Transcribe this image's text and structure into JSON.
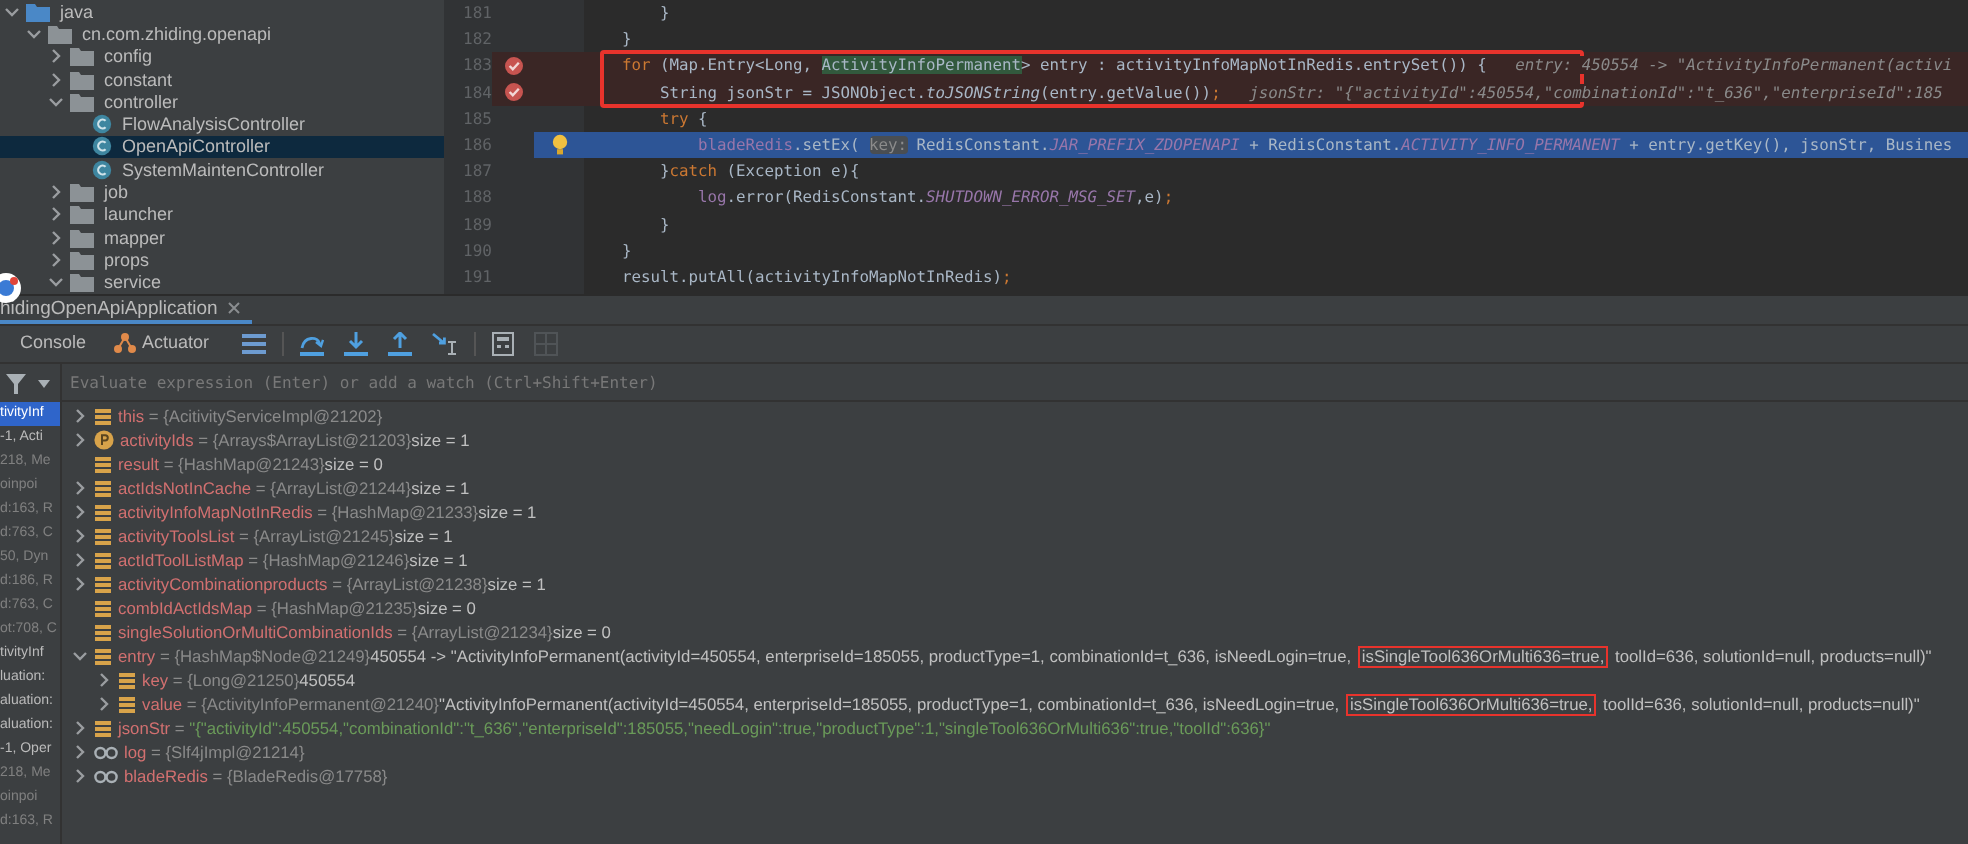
{
  "project_tree": [
    {
      "label": "java",
      "kind": "source-root",
      "expanded": true,
      "selected": false,
      "children": [
        {
          "label": "cn.com.zhiding.openapi",
          "kind": "package",
          "expanded": true,
          "selected": false,
          "children": [
            {
              "label": "config",
              "kind": "package",
              "expanded": false,
              "selected": false
            },
            {
              "label": "constant",
              "kind": "package",
              "expanded": false,
              "selected": false
            },
            {
              "label": "controller",
              "kind": "package",
              "expanded": true,
              "selected": false,
              "children": [
                {
                  "label": "FlowAnalysisController",
                  "kind": "class",
                  "selected": false
                },
                {
                  "label": "OpenApiController",
                  "kind": "class",
                  "selected": true
                },
                {
                  "label": "SystemMaintenController",
                  "kind": "class",
                  "selected": false
                }
              ]
            },
            {
              "label": "job",
              "kind": "package",
              "expanded": false,
              "selected": false
            },
            {
              "label": "launcher",
              "kind": "package",
              "expanded": false,
              "selected": false
            },
            {
              "label": "mapper",
              "kind": "package",
              "expanded": false,
              "selected": false
            },
            {
              "label": "props",
              "kind": "package",
              "expanded": false,
              "selected": false
            },
            {
              "label": "service",
              "kind": "package",
              "expanded": true,
              "selected": false
            }
          ]
        }
      ]
    }
  ],
  "code_lines": [
    {
      "number": "181",
      "breakpoint": false,
      "current": false,
      "segments": [
        {
          "kind": "plain",
          "text": "        }"
        }
      ]
    },
    {
      "number": "182",
      "breakpoint": false,
      "current": false,
      "segments": [
        {
          "kind": "plain",
          "text": "    }"
        }
      ]
    },
    {
      "number": "183",
      "breakpoint": true,
      "current": false,
      "segments": [
        {
          "kind": "keyword",
          "text": "    for"
        },
        {
          "kind": "plain",
          "text": " (Map.Entry<Long, "
        },
        {
          "kind": "highlight",
          "text": "ActivityInfoPermanent"
        },
        {
          "kind": "plain",
          "text": "> entry : activityInfoMapNotInRedis.entrySet()) {"
        },
        {
          "kind": "hint",
          "text": "   entry: 450554 -> \"ActivityInfoPermanent(activi"
        }
      ]
    },
    {
      "number": "184",
      "breakpoint": true,
      "current": false,
      "segments": [
        {
          "kind": "plain",
          "text": "        String jsonStr = JSONObject."
        },
        {
          "kind": "italic",
          "text": "toJSONString"
        },
        {
          "kind": "plain",
          "text": "(entry.getValue())"
        },
        {
          "kind": "keyword",
          "text": ";"
        },
        {
          "kind": "hint",
          "text": "   jsonStr: \"{\"activityId\":450554,\"combinationId\":\"t_636\",\"enterpriseId\":185"
        }
      ]
    },
    {
      "number": "185",
      "breakpoint": false,
      "current": false,
      "segments": [
        {
          "kind": "keyword",
          "text": "        try"
        },
        {
          "kind": "plain",
          "text": " {"
        }
      ]
    },
    {
      "number": "186",
      "breakpoint": false,
      "current": true,
      "segments": [
        {
          "kind": "field",
          "text": "            bladeRedis"
        },
        {
          "kind": "plain",
          "text": ".setEx( "
        },
        {
          "kind": "inlay",
          "text": "key:"
        },
        {
          "kind": "plain",
          "text": " RedisConstant."
        },
        {
          "kind": "static",
          "text": "JAR_PREFIX_ZDOPENAPI"
        },
        {
          "kind": "plain",
          "text": " + RedisConstant."
        },
        {
          "kind": "static",
          "text": "ACTIVITY_INFO_PERMANENT"
        },
        {
          "kind": "plain",
          "text": " + entry.getKey(), jsonStr, Busines"
        }
      ]
    },
    {
      "number": "187",
      "breakpoint": false,
      "current": false,
      "segments": [
        {
          "kind": "plain",
          "text": "        }"
        },
        {
          "kind": "keyword",
          "text": "catch"
        },
        {
          "kind": "plain",
          "text": " (Exception e){"
        }
      ]
    },
    {
      "number": "188",
      "breakpoint": false,
      "current": false,
      "segments": [
        {
          "kind": "field",
          "text": "            log"
        },
        {
          "kind": "plain",
          "text": ".error(RedisConstant."
        },
        {
          "kind": "static",
          "text": "SHUTDOWN_ERROR_MSG_SET"
        },
        {
          "kind": "plain",
          "text": ",e)"
        },
        {
          "kind": "keyword",
          "text": ";"
        }
      ]
    },
    {
      "number": "189",
      "breakpoint": false,
      "current": false,
      "segments": [
        {
          "kind": "plain",
          "text": "        }"
        }
      ]
    },
    {
      "number": "190",
      "breakpoint": false,
      "current": false,
      "segments": [
        {
          "kind": "plain",
          "text": "    }"
        }
      ]
    },
    {
      "number": "191",
      "breakpoint": false,
      "current": false,
      "segments": [
        {
          "kind": "plain",
          "text": "    result.putAll(activityInfoMapNotInRedis)"
        },
        {
          "kind": "keyword",
          "text": ";"
        }
      ]
    }
  ],
  "run_tabs": [
    {
      "label": "hidingOpenApiApplication",
      "selected": true
    }
  ],
  "debug_tabs": [
    {
      "label": "Console",
      "kind": "console",
      "selected": false
    },
    {
      "label": "Actuator",
      "kind": "actuator",
      "selected": false
    }
  ],
  "toolbar_buttons": [
    {
      "kind": "frames-menu",
      "disabled": false
    },
    {
      "kind": "step-over",
      "disabled": false
    },
    {
      "kind": "step-into",
      "disabled": false
    },
    {
      "kind": "step-out",
      "disabled": false
    },
    {
      "kind": "run-to-cursor",
      "disabled": false
    },
    {
      "kind": "evaluate",
      "disabled": false
    },
    {
      "kind": "table",
      "disabled": true
    }
  ],
  "watch_field": {
    "placeholder": "Evaluate expression (Enter) or add a watch (Ctrl+Shift+Enter)"
  },
  "frames": [
    {
      "label": "tivityInf",
      "selected": true,
      "dimmed": false
    },
    {
      "label": "-1, Acti",
      "selected": false,
      "dimmed": false
    },
    {
      "label": "218, Me",
      "selected": false,
      "dimmed": true
    },
    {
      "label": "oinpoi",
      "selected": false,
      "dimmed": true
    },
    {
      "label": "d:163, R",
      "selected": false,
      "dimmed": true
    },
    {
      "label": "d:763, C",
      "selected": false,
      "dimmed": true
    },
    {
      "label": "50, Dyn",
      "selected": false,
      "dimmed": true
    },
    {
      "label": "d:186, R",
      "selected": false,
      "dimmed": true
    },
    {
      "label": "d:763, C",
      "selected": false,
      "dimmed": true
    },
    {
      "label": "ot:708, C",
      "selected": false,
      "dimmed": true
    },
    {
      "label": "tivityInf",
      "selected": false,
      "dimmed": false
    },
    {
      "label": "luation:",
      "selected": false,
      "dimmed": false
    },
    {
      "label": "aluation:",
      "selected": false,
      "dimmed": false
    },
    {
      "label": "aluation:",
      "selected": false,
      "dimmed": false
    },
    {
      "label": "-1, Oper",
      "selected": false,
      "dimmed": false
    },
    {
      "label": "218, Me",
      "selected": false,
      "dimmed": true
    },
    {
      "label": "oinpoi",
      "selected": false,
      "dimmed": true
    },
    {
      "label": "d:163, R",
      "selected": false,
      "dimmed": true
    }
  ],
  "variables": [
    {
      "name": "this",
      "kind": "field",
      "expanded": false,
      "sep": "=",
      "type": "{AcitivityServiceImpl@21202}"
    },
    {
      "name": "activityIds",
      "kind": "parameter",
      "expanded": false,
      "sep": "=",
      "type": "{Arrays$ArrayList@21203}",
      "value": "size = 1"
    },
    {
      "name": "result",
      "kind": "field",
      "sep": "=",
      "type": "{HashMap@21243}",
      "value": "size = 0"
    },
    {
      "name": "actIdsNotInCache",
      "kind": "field",
      "expanded": false,
      "sep": "=",
      "type": "{ArrayList@21244}",
      "value": "size = 1"
    },
    {
      "name": "activityInfoMapNotInRedis",
      "kind": "field",
      "expanded": false,
      "sep": "=",
      "type": "{HashMap@21233}",
      "value": "size = 1"
    },
    {
      "name": "activityToolsList",
      "kind": "field",
      "expanded": false,
      "sep": "=",
      "type": "{ArrayList@21245}",
      "value": "size = 1"
    },
    {
      "name": "actIdToolListMap",
      "kind": "field",
      "expanded": false,
      "sep": "=",
      "type": "{HashMap@21246}",
      "value": "size = 1"
    },
    {
      "name": "activityCombinationproducts",
      "kind": "field",
      "expanded": false,
      "sep": "=",
      "type": "{ArrayList@21238}",
      "value": "size = 1"
    },
    {
      "name": "combIdActIdsMap",
      "kind": "field",
      "sep": "=",
      "type": "{HashMap@21235}",
      "value": "size = 0"
    },
    {
      "name": "singleSolutionOrMultiCombinationIds",
      "kind": "field",
      "sep": "=",
      "type": "{ArrayList@21234}",
      "value": "size = 0"
    },
    {
      "name": "entry",
      "kind": "field",
      "expanded": true,
      "sep": "=",
      "type": "{HashMap$Node@21249}",
      "value": [
        {
          "text": "450554 -> \"ActivityInfoPermanent(activityId=450554, enterpriseId=185055, productType=1, combinationId=t_636, isNeedLogin=true, ",
          "annotated": false
        },
        {
          "text": "isSingleTool636OrMulti636=true,",
          "annotated": true
        },
        {
          "text": " toolId=636, solutionId=null, products=null)\"",
          "annotated": false
        }
      ],
      "children": [
        {
          "name": "key",
          "kind": "field",
          "expanded": false,
          "sep": "=",
          "type": "{Long@21250}",
          "value": "450554"
        },
        {
          "name": "value",
          "kind": "field",
          "expanded": false,
          "sep": "=",
          "type": "{ActivityInfoPermanent@21240}",
          "value": [
            {
              "text": "\"ActivityInfoPermanent(activityId=450554, enterpriseId=185055, productType=1, combinationId=t_636, isNeedLogin=true, ",
              "annotated": false
            },
            {
              "text": "isSingleTool636OrMulti636=true,",
              "annotated": true
            },
            {
              "text": " toolId=636, solutionId=null, products=null)\"",
              "annotated": false
            }
          ]
        }
      ]
    },
    {
      "name": "jsonStr",
      "kind": "field",
      "expanded": false,
      "sep": "=",
      "string_value": "\"{\"activityId\":450554,\"combinationId\":\"t_636\",\"enterpriseId\":185055,\"needLogin\":true,\"productType\":1,\"singleTool636OrMulti636\":true,\"toolId\":636}\""
    },
    {
      "name": "log",
      "kind": "object",
      "expanded": false,
      "sep": "=",
      "type": "{Slf4jImpl@21214}"
    },
    {
      "name": "bladeRedis",
      "kind": "object",
      "expanded": false,
      "sep": "=",
      "type": "{BladeRedis@17758}"
    }
  ]
}
